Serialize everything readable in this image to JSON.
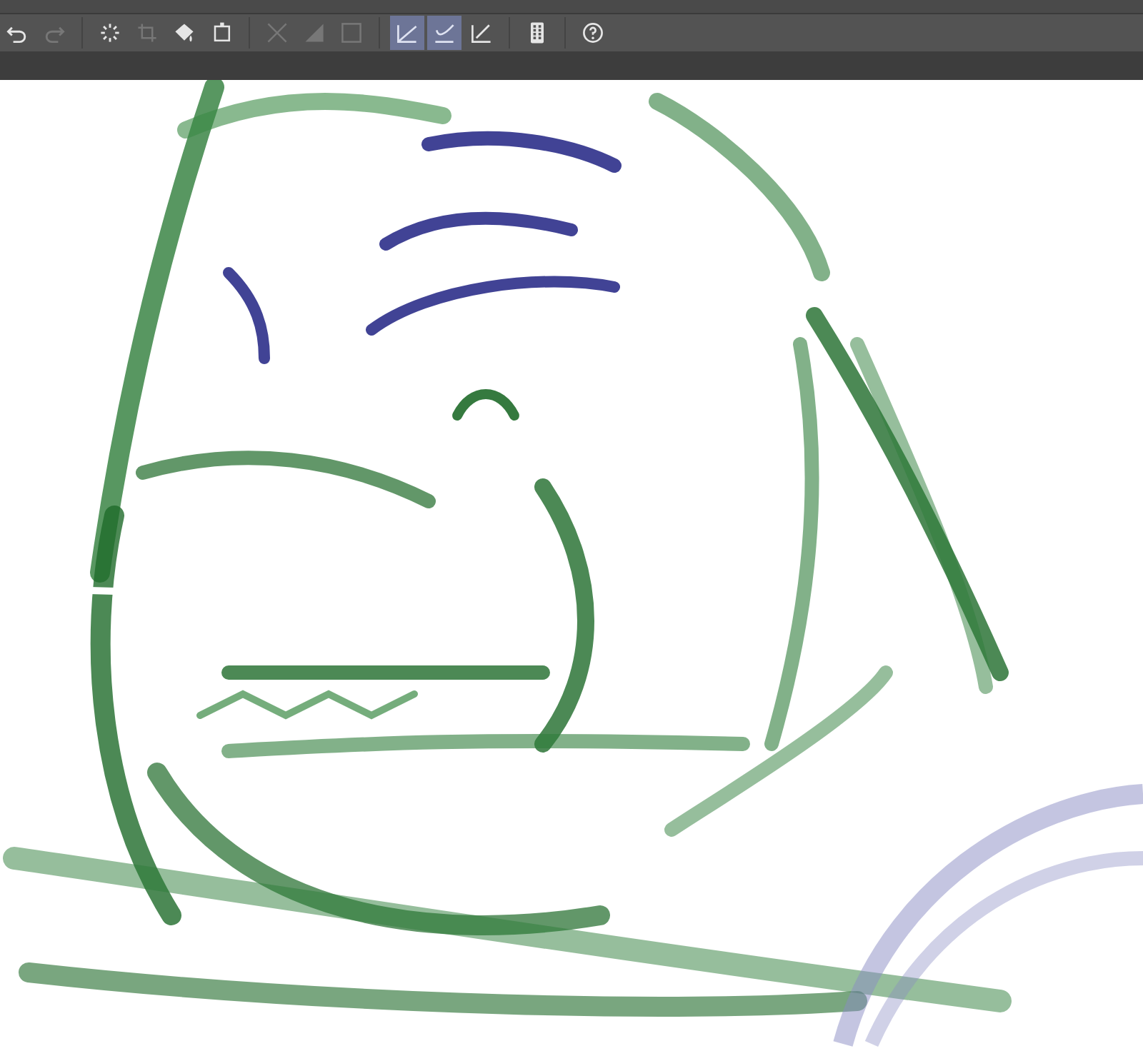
{
  "toolbar": {
    "buttons": [
      {
        "kind": "undo",
        "disabled": false,
        "selected": false
      },
      {
        "kind": "redo",
        "disabled": true,
        "selected": false
      },
      {
        "kind": "sep"
      },
      {
        "kind": "burst",
        "disabled": false,
        "selected": false
      },
      {
        "kind": "crop",
        "disabled": true,
        "selected": false
      },
      {
        "kind": "fill",
        "disabled": false,
        "selected": false
      },
      {
        "kind": "transform",
        "disabled": false,
        "selected": false
      },
      {
        "kind": "sep"
      },
      {
        "kind": "diagonal",
        "disabled": true,
        "selected": false
      },
      {
        "kind": "triangle",
        "disabled": true,
        "selected": false
      },
      {
        "kind": "square",
        "disabled": true,
        "selected": false
      },
      {
        "kind": "sep"
      },
      {
        "kind": "angle",
        "disabled": false,
        "selected": true
      },
      {
        "kind": "curve",
        "disabled": false,
        "selected": true
      },
      {
        "kind": "pen",
        "disabled": false,
        "selected": false
      },
      {
        "kind": "sep"
      },
      {
        "kind": "device",
        "disabled": false,
        "selected": false
      },
      {
        "kind": "sep"
      },
      {
        "kind": "help",
        "disabled": false,
        "selected": false
      }
    ]
  }
}
